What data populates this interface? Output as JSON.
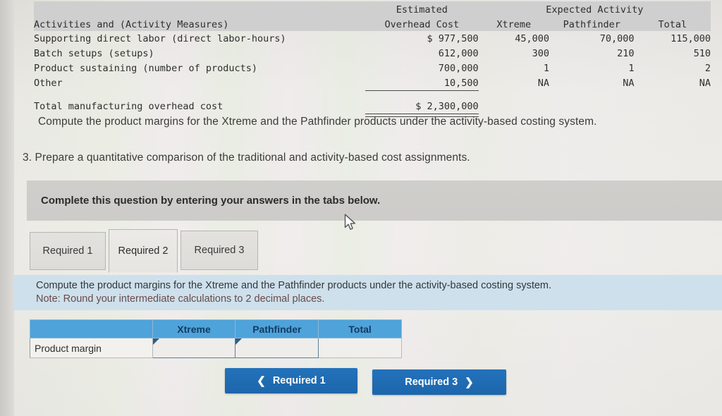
{
  "overhead_table": {
    "header": {
      "col_label": "Activities and (Activity Measures)",
      "estimated": "Estimated",
      "overhead_cost": "Overhead Cost",
      "expected_activity": "Expected Activity",
      "xtreme": "Xtreme",
      "pathfinder": "Pathfinder",
      "total": "Total"
    },
    "rows": [
      {
        "label": "Supporting direct labor (direct labor-hours)",
        "cost": "$ 977,500",
        "xtreme": "45,000",
        "pathfinder": "70,000",
        "total": "115,000"
      },
      {
        "label": "Batch setups (setups)",
        "cost": "612,000",
        "xtreme": "300",
        "pathfinder": "210",
        "total": "510"
      },
      {
        "label": "Product sustaining (number of products)",
        "cost": "700,000",
        "xtreme": "1",
        "pathfinder": "1",
        "total": "2"
      },
      {
        "label": "Other",
        "cost": "10,500",
        "xtreme": "NA",
        "pathfinder": "NA",
        "total": "NA"
      }
    ],
    "total_row": {
      "label": "Total manufacturing overhead cost",
      "cost": "$ 2,300,000",
      "xtreme": "",
      "pathfinder": "",
      "total": ""
    }
  },
  "questions": {
    "compute_line": "Compute the product margins for the Xtreme and the Pathfinder products under the activity-based costing system.",
    "item_three": "3. Prepare a quantitative comparison of the traditional and activity-based cost assignments."
  },
  "banner": {
    "text": "Complete this question by entering your answers in the tabs below."
  },
  "tabs": {
    "items": [
      {
        "label": "Required 1",
        "active": false
      },
      {
        "label": "Required 2",
        "active": true
      },
      {
        "label": "Required 3",
        "active": false
      }
    ]
  },
  "instruction_panel": {
    "line1": "Compute the product margins for the Xtreme and the Pathfinder products under the activity-based costing system.",
    "line2": "Note: Round your intermediate calculations to 2 decimal places."
  },
  "answer_grid": {
    "columns": [
      "",
      "Xtreme",
      "Pathfinder",
      "Total"
    ],
    "rows": [
      {
        "label": "Product margin",
        "xtreme": "",
        "pathfinder": "",
        "total": ""
      }
    ]
  },
  "nav": {
    "prev_label": "Required 1",
    "prev_icon": "chevron-left-icon",
    "next_label": "Required 3",
    "next_icon": "chevron-right-icon"
  },
  "colors": {
    "table_header_blue": "#4ea3da",
    "panel_blue": "#cde0ec",
    "button_blue": "#2372bb",
    "banner_gray": "#cecdca",
    "input_border": "#5f7f96",
    "note_text": "#6b4a4a"
  }
}
